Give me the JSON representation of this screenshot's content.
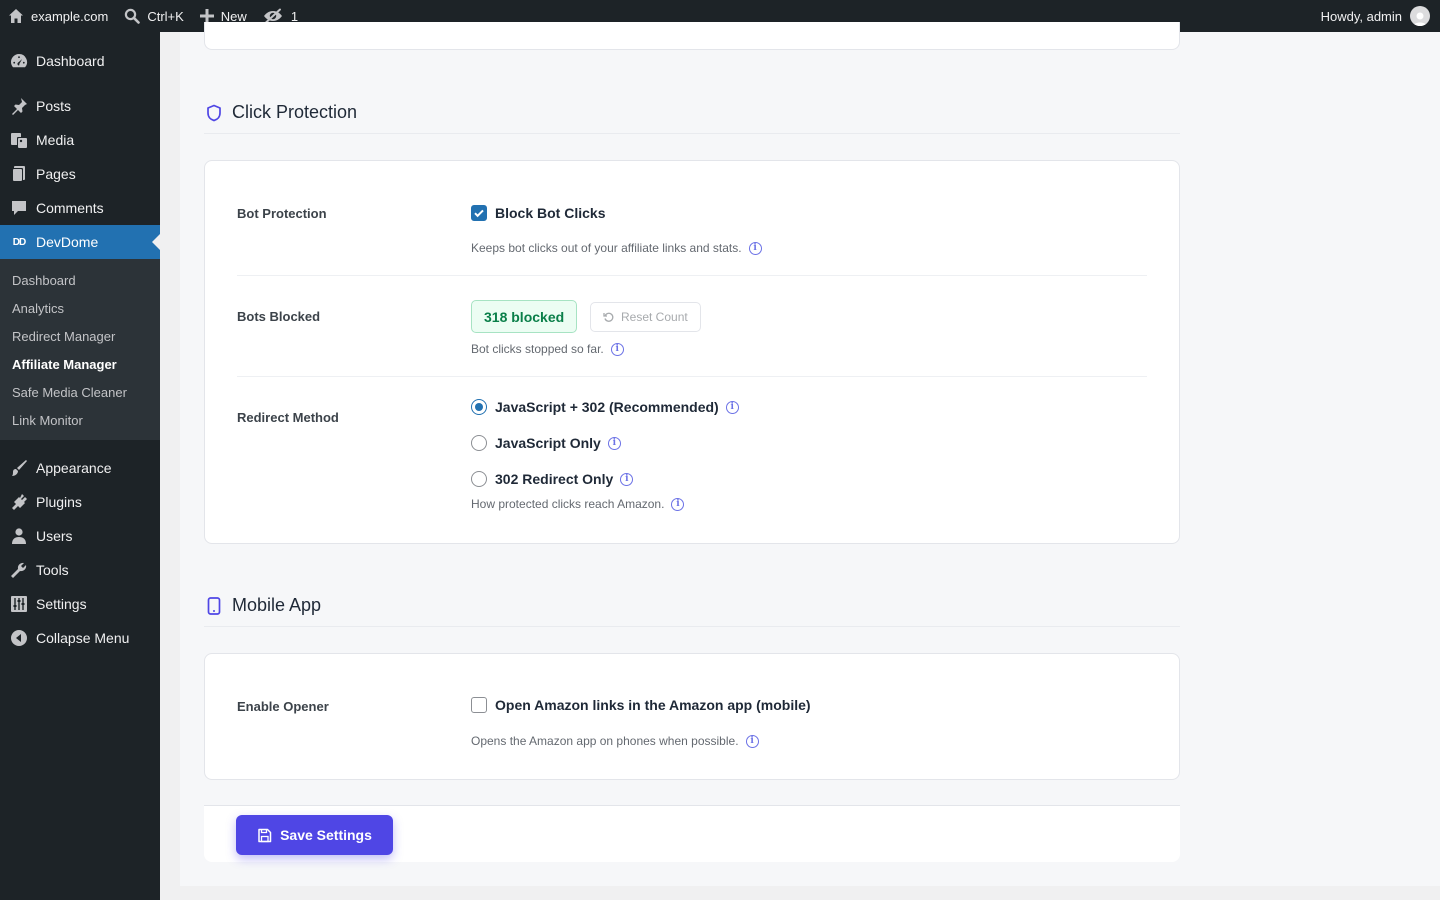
{
  "adminbar": {
    "site": "example.com",
    "search_shortcut": "Ctrl+K",
    "new_label": "New",
    "hidden_count": "1",
    "howdy": "Howdy, admin"
  },
  "sidebar": {
    "items_top": [
      {
        "label": "Dashboard",
        "icon": "dashboard-icon"
      },
      {
        "label": "Posts",
        "icon": "pin-icon"
      },
      {
        "label": "Media",
        "icon": "media-icon"
      },
      {
        "label": "Pages",
        "icon": "pages-icon"
      },
      {
        "label": "Comments",
        "icon": "comment-icon"
      },
      {
        "label": "DevDome",
        "icon": "devdome-icon"
      }
    ],
    "submenu": [
      "Dashboard",
      "Analytics",
      "Redirect Manager",
      "Affiliate Manager",
      "Safe Media Cleaner",
      "Link Monitor"
    ],
    "active_submenu": "Affiliate Manager",
    "items_bottom": [
      {
        "label": "Appearance",
        "icon": "brush-icon"
      },
      {
        "label": "Plugins",
        "icon": "plugin-icon"
      },
      {
        "label": "Users",
        "icon": "user-icon"
      },
      {
        "label": "Tools",
        "icon": "wrench-icon"
      },
      {
        "label": "Settings",
        "icon": "sliders-icon"
      },
      {
        "label": "Collapse Menu",
        "icon": "collapse-icon"
      }
    ]
  },
  "click_protection": {
    "title": "Click Protection",
    "bot_protection": {
      "label": "Bot Protection",
      "checkbox_label": "Block Bot Clicks",
      "checked": true,
      "help": "Keeps bot clicks out of your affiliate links and stats."
    },
    "bots_blocked": {
      "label": "Bots Blocked",
      "badge": "318 blocked",
      "reset_label": "Reset Count",
      "help": "Bot clicks stopped so far."
    },
    "redirect_method": {
      "label": "Redirect Method",
      "options": [
        "JavaScript + 302 (Recommended)",
        "JavaScript Only",
        "302 Redirect Only"
      ],
      "selected": "JavaScript + 302 (Recommended)",
      "help": "How protected clicks reach Amazon."
    }
  },
  "mobile_app": {
    "title": "Mobile App",
    "enable_opener": {
      "label": "Enable Opener",
      "checkbox_label": "Open Amazon links in the Amazon app (mobile)",
      "checked": false,
      "help": "Opens the Amazon app on phones when possible."
    }
  },
  "save_label": "Save Settings",
  "colors": {
    "accent": "#4f46e5",
    "wp_blue": "#2271b1",
    "success": "#0a7f49"
  }
}
